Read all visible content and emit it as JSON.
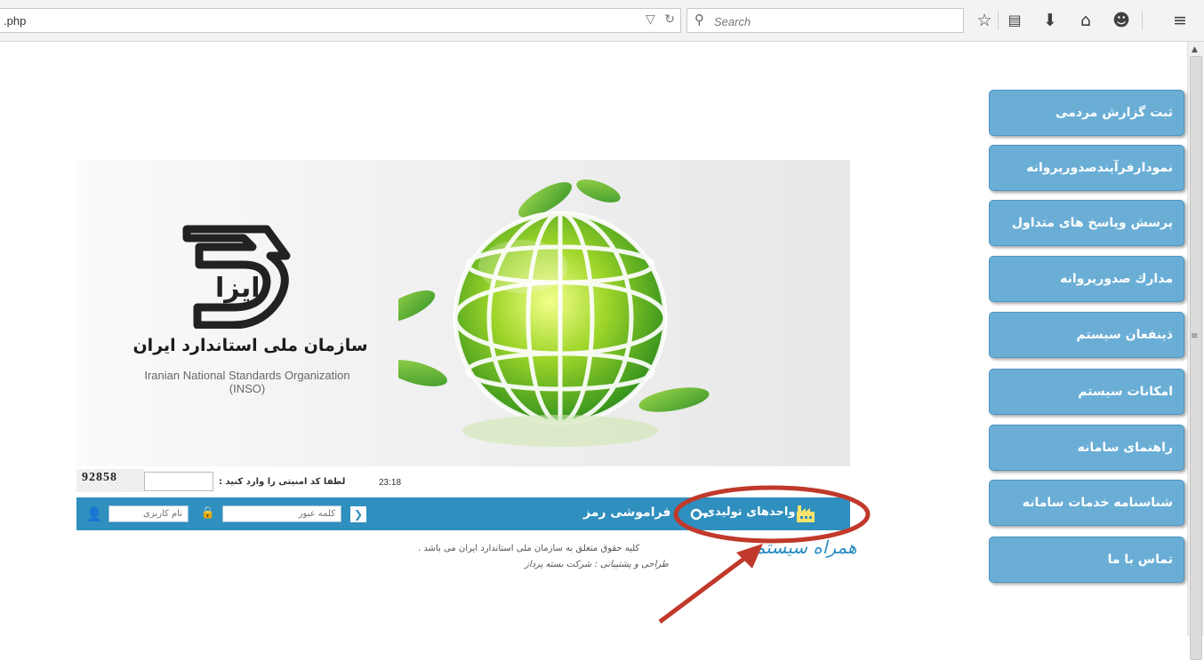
{
  "browser": {
    "url": ".php",
    "search_placeholder": "Search"
  },
  "sidebar": {
    "items": [
      {
        "label": "ثبت گزارش مردمی"
      },
      {
        "label": "نمودارفرآیندصدورپروانه"
      },
      {
        "label": "پرسش وپاسخ های متداول"
      },
      {
        "label": "مدارك صدورپروانه"
      },
      {
        "label": "ذینفعان سیستم"
      },
      {
        "label": "امکانات سیستم"
      },
      {
        "label": "راهنمای سامانه"
      },
      {
        "label": "شناسنامه خدمات سامانه"
      },
      {
        "label": "تماس با ما"
      }
    ]
  },
  "banner": {
    "logo_text": "ایزا",
    "org_name_fa": "سازمان ملی استاندارد ایران",
    "org_name_en_line1": "Iranian National Standards Organization",
    "org_name_en_line2": "(INSO)"
  },
  "captcha": {
    "image_text": "92858",
    "label": "لطفا کد امنیتی را وارد کنید :",
    "timer": "23:18"
  },
  "login": {
    "username_placeholder": "نام کاربری",
    "password_placeholder": "کلمه عبور",
    "forgot_label": "فراموشی رمز",
    "production_units_label": "واحدهای تولیدی"
  },
  "footer": {
    "copyright": "کلیه حقوق متعلق به سازمان ملی استاندارد ایران می باشد .",
    "credit": "طراحی و پشتیبانی : شرکت بسته پرداز",
    "brand": "همراه سیستم"
  },
  "colors": {
    "menu_bg": "#6aaed6",
    "login_bar": "#2f8fbe",
    "annotation": "#c0392b"
  }
}
